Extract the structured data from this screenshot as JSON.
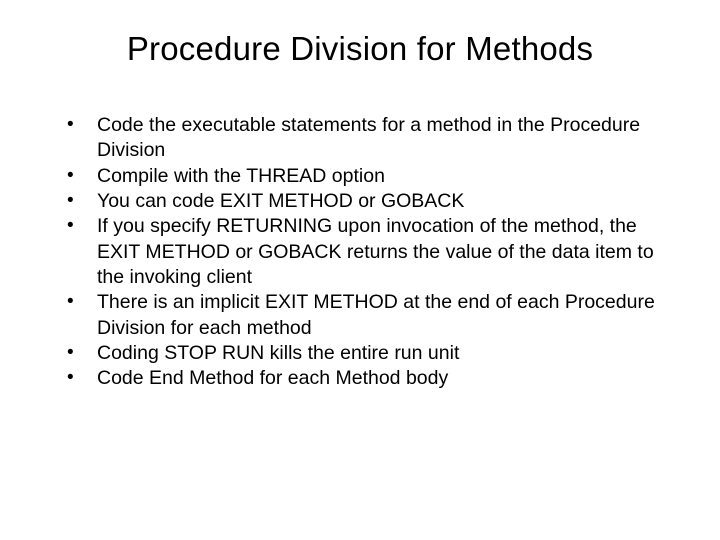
{
  "title": "Procedure Division for Methods",
  "bullets": [
    "Code the executable statements for a method in the Procedure Division",
    "Compile with the THREAD option",
    "You can code EXIT METHOD or GOBACK",
    "If you specify RETURNING upon invocation of the method, the EXIT METHOD or GOBACK returns the value of the data item to the invoking client",
    "There is an implicit EXIT METHOD at the end of each Procedure Division for each method",
    "Coding STOP RUN kills the entire run unit",
    "Code End Method for each Method body"
  ]
}
